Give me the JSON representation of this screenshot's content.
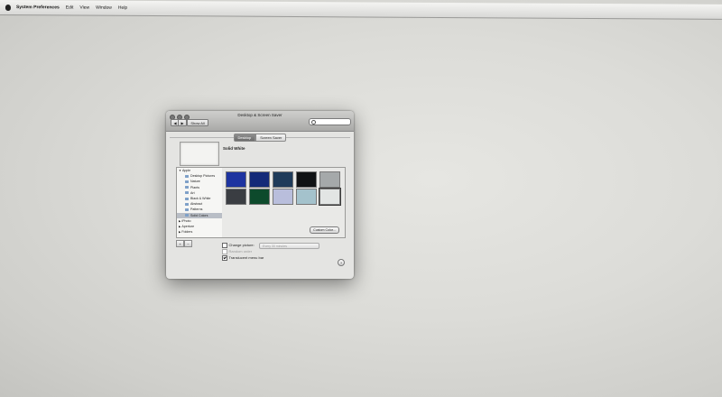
{
  "menubar": {
    "app_name": "System Preferences",
    "items": [
      "Edit",
      "View",
      "Window",
      "Help"
    ]
  },
  "window": {
    "title": "Desktop & Screen Saver",
    "back_label": "◀",
    "forward_label": "▶",
    "show_all_label": "Show All",
    "search_placeholder": ""
  },
  "tabs": [
    {
      "label": "Desktop",
      "active": true
    },
    {
      "label": "Screen Saver",
      "active": false
    }
  ],
  "preview": {
    "selected_name": "Solid White"
  },
  "sidebar": {
    "groups": [
      {
        "label": "Apple",
        "expanded": true,
        "children": [
          "Desktop Pictures",
          "Nature",
          "Plants",
          "Art",
          "Black & White",
          "Abstract",
          "Patterns",
          "Solid Colors"
        ],
        "selected_child": "Solid Colors"
      },
      {
        "label": "iPhoto",
        "expanded": false
      },
      {
        "label": "Aperture",
        "expanded": false
      },
      {
        "label": "Folders",
        "expanded": false
      }
    ],
    "add_label": "+",
    "remove_label": "−"
  },
  "swatches": {
    "row1": [
      "#1e34a0",
      "#142a78",
      "#1f3b5a",
      "#101214",
      "#a5a9aa"
    ],
    "row2": [
      "#3a3d42",
      "#0d4a2c",
      "#b9bedc",
      "#a4c2cc",
      "#e2e5e4"
    ],
    "selected": "row2-5"
  },
  "custom_color_label": "Custom Color...",
  "options": {
    "change_picture_label": "Change picture:",
    "change_picture_checked": false,
    "interval_value": "Every 30 minutes",
    "random_order_label": "Random order",
    "translucent_label": "Translucent menu bar",
    "translucent_checked": true
  },
  "help_label": "?"
}
